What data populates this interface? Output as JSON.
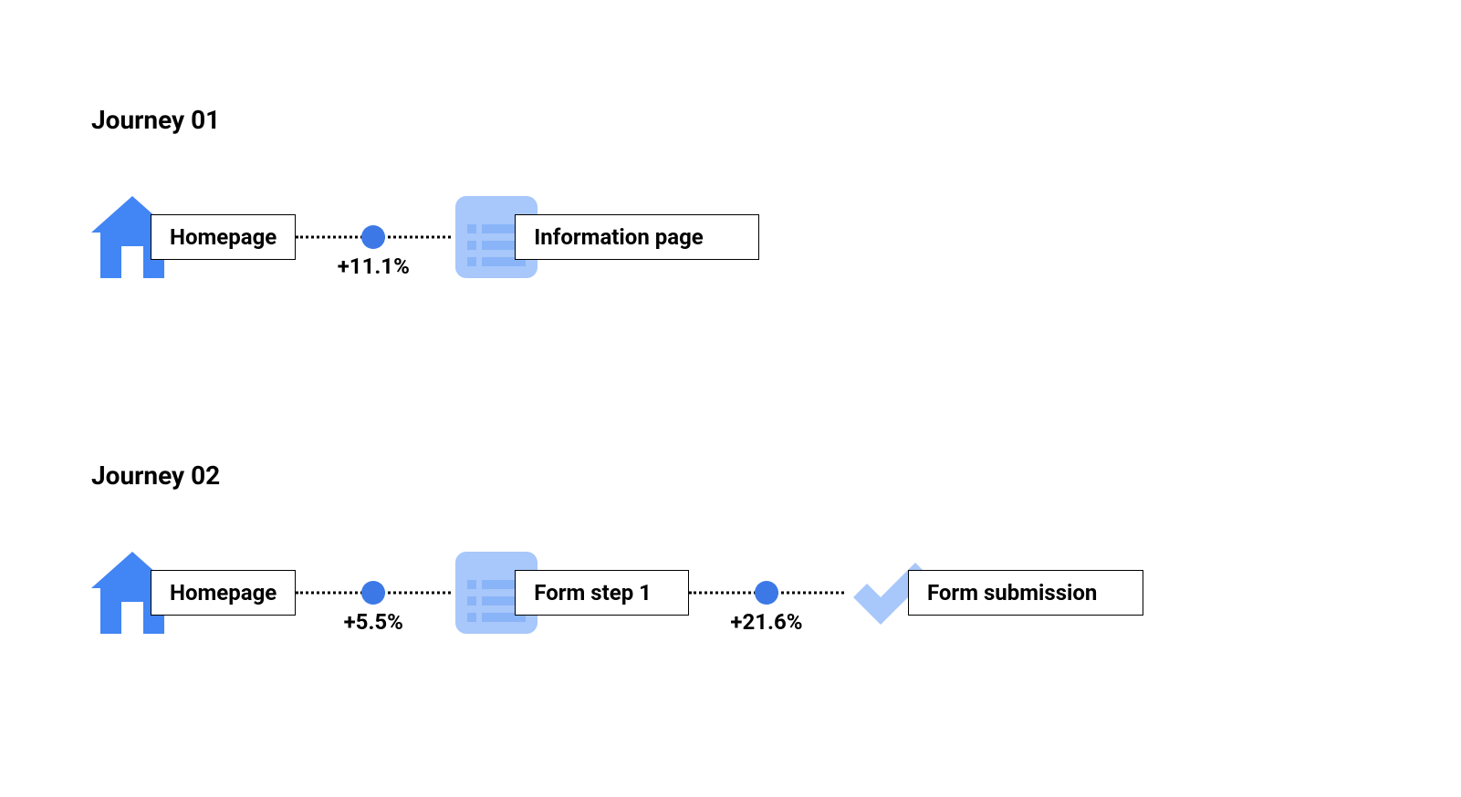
{
  "colors": {
    "primary": "#4285f4",
    "light": "#a8c7fa",
    "mid": "#8ab4f8",
    "dot": "#3c79e6"
  },
  "journeys": [
    {
      "title": "Journey 01",
      "steps": [
        {
          "icon": "home",
          "label": "Homepage"
        },
        {
          "icon": "list-page",
          "label": "Information page"
        }
      ],
      "connectors": [
        {
          "value": "+11.1%"
        }
      ]
    },
    {
      "title": "Journey 02",
      "steps": [
        {
          "icon": "home",
          "label": "Homepage"
        },
        {
          "icon": "list-page",
          "label": "Form step 1"
        },
        {
          "icon": "checkmark",
          "label": "Form submission"
        }
      ],
      "connectors": [
        {
          "value": "+5.5%"
        },
        {
          "value": "+21.6%"
        }
      ]
    }
  ]
}
